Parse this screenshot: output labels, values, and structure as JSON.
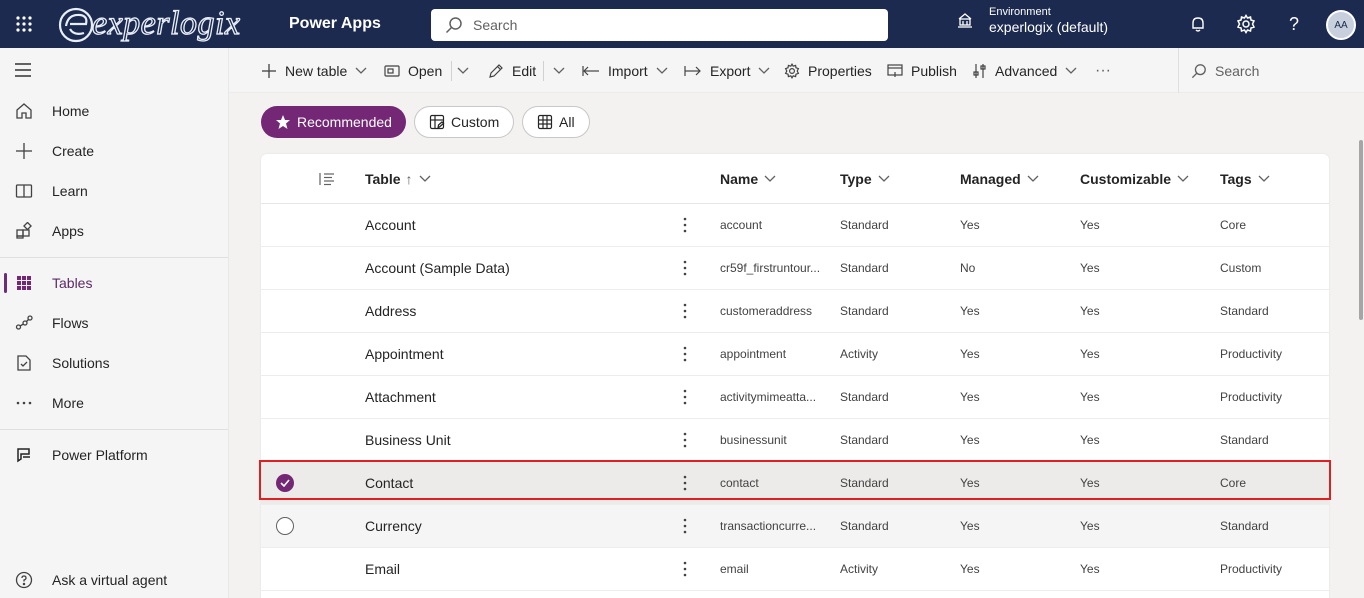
{
  "header": {
    "logo_text": "experlogix",
    "app_name": "Power Apps",
    "search_placeholder": "Search",
    "environment_label": "Environment",
    "environment_name": "experlogix (default)",
    "avatar_initials": "AA"
  },
  "nav": {
    "items": [
      {
        "label": "Home",
        "icon": "home-icon"
      },
      {
        "label": "Create",
        "icon": "plus-icon"
      },
      {
        "label": "Learn",
        "icon": "book-icon"
      },
      {
        "label": "Apps",
        "icon": "apps-icon"
      },
      {
        "label": "Tables",
        "icon": "table-grid-icon",
        "active": true
      },
      {
        "label": "Flows",
        "icon": "flow-icon"
      },
      {
        "label": "Solutions",
        "icon": "solutions-icon"
      },
      {
        "label": "More",
        "icon": "ellipsis-icon"
      },
      {
        "label": "Power Platform",
        "icon": "power-platform-icon"
      }
    ],
    "footer": {
      "label": "Ask a virtual agent",
      "icon": "help-circle-icon"
    }
  },
  "commands": {
    "new_table": "New table",
    "open": "Open",
    "edit": "Edit",
    "import": "Import",
    "export": "Export",
    "properties": "Properties",
    "publish": "Publish",
    "advanced": "Advanced",
    "overflow": "···",
    "search_placeholder": "Search"
  },
  "filters": [
    {
      "label": "Recommended",
      "selected": true
    },
    {
      "label": "Custom",
      "selected": false
    },
    {
      "label": "All",
      "selected": false
    }
  ],
  "table": {
    "columns": {
      "table": "Table",
      "sort_arrow": "↑",
      "name": "Name",
      "type": "Type",
      "managed": "Managed",
      "customizable": "Customizable",
      "tags": "Tags"
    },
    "rows": [
      {
        "table": "Account",
        "name": "account",
        "type": "Standard",
        "managed": "Yes",
        "customizable": "Yes",
        "tags": "Core"
      },
      {
        "table": "Account (Sample Data)",
        "name": "cr59f_firstruntour...",
        "type": "Standard",
        "managed": "No",
        "customizable": "Yes",
        "tags": "Custom"
      },
      {
        "table": "Address",
        "name": "customeraddress",
        "type": "Standard",
        "managed": "Yes",
        "customizable": "Yes",
        "tags": "Standard"
      },
      {
        "table": "Appointment",
        "name": "appointment",
        "type": "Activity",
        "managed": "Yes",
        "customizable": "Yes",
        "tags": "Productivity"
      },
      {
        "table": "Attachment",
        "name": "activitymimeatta...",
        "type": "Standard",
        "managed": "Yes",
        "customizable": "Yes",
        "tags": "Productivity"
      },
      {
        "table": "Business Unit",
        "name": "businessunit",
        "type": "Standard",
        "managed": "Yes",
        "customizable": "Yes",
        "tags": "Standard"
      },
      {
        "table": "Contact",
        "name": "contact",
        "type": "Standard",
        "managed": "Yes",
        "customizable": "Yes",
        "tags": "Core",
        "selected": true
      },
      {
        "table": "Currency",
        "name": "transactioncurre...",
        "type": "Standard",
        "managed": "Yes",
        "customizable": "Yes",
        "tags": "Standard",
        "hovered": true
      },
      {
        "table": "Email",
        "name": "email",
        "type": "Activity",
        "managed": "Yes",
        "customizable": "Yes",
        "tags": "Productivity"
      }
    ]
  },
  "colors": {
    "header_bg": "#1b2a4e",
    "accent": "#742774",
    "highlight": "#e02020"
  }
}
